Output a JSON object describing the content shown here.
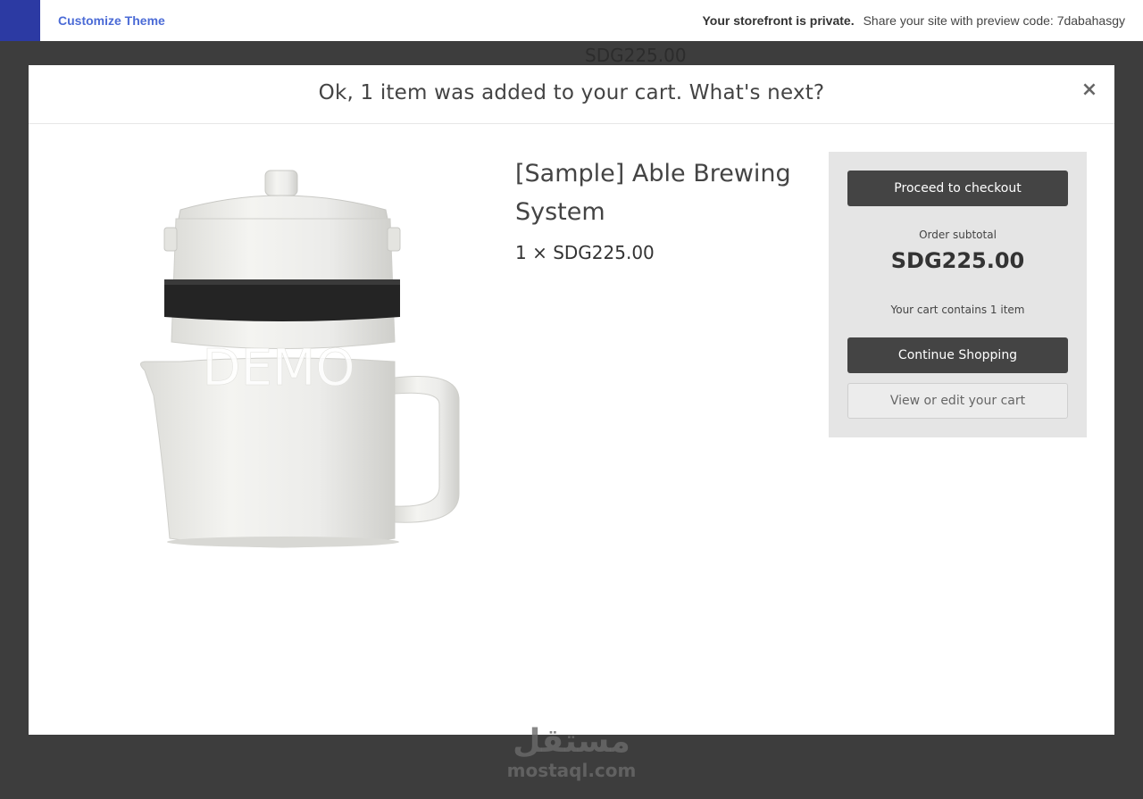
{
  "topbar": {
    "customize_label": "Customize Theme",
    "private_label": "Your storefront is private.",
    "share_text": "Share your site with preview code: 7dabahasgy",
    "brand_color": "#2c3aa3",
    "link_color": "#4b6bd6"
  },
  "background": {
    "price": "SDG225.00"
  },
  "modal": {
    "title": "Ok, 1 item was added to your cart. What's next?",
    "close_symbol": "×",
    "product": {
      "image_label": "DEMO",
      "name": "[Sample] Able Brewing System",
      "quantity_price": "1 × SDG225.00"
    },
    "cart": {
      "checkout_label": "Proceed to checkout",
      "subtotal_label": "Order subtotal",
      "subtotal_value": "SDG225.00",
      "count_text": "Your cart contains 1 item",
      "continue_label": "Continue Shopping",
      "view_label": "View or edit your cart"
    }
  },
  "watermark": {
    "arabic": "مستقل",
    "latin": "mostaql.com"
  }
}
